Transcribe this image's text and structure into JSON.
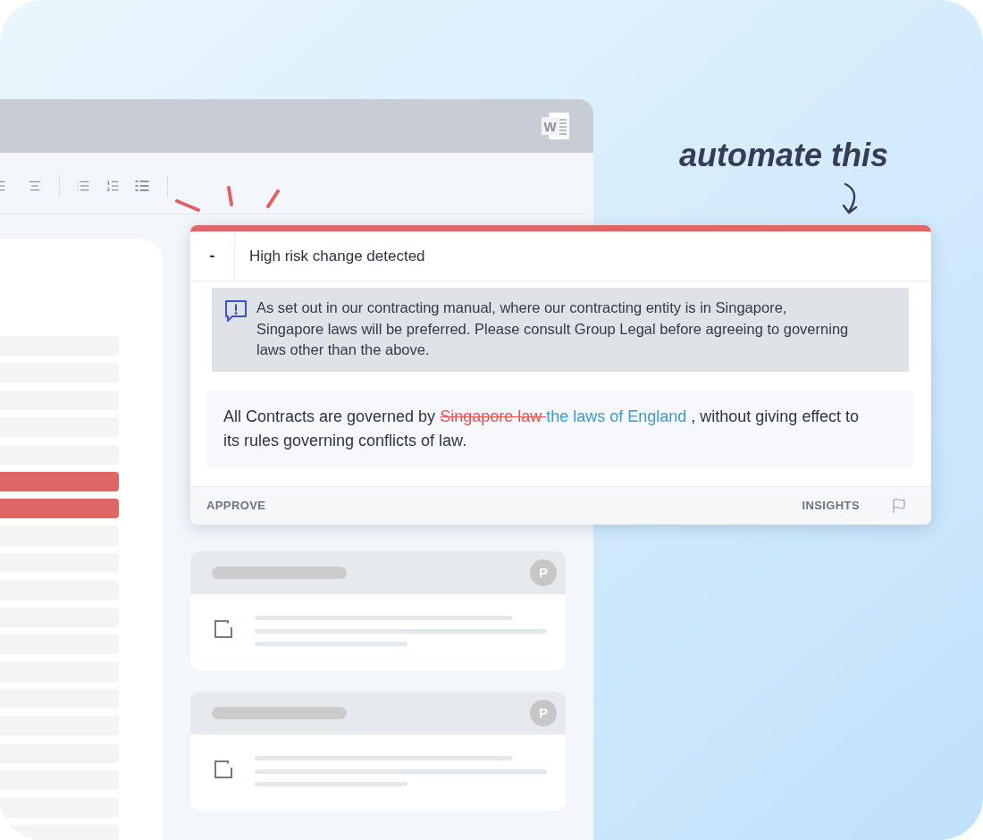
{
  "annotation": {
    "text": "automate this"
  },
  "window": {
    "app_icon_letter": "W"
  },
  "document": {
    "lines": [
      {
        "highlighted": false
      },
      {
        "highlighted": false
      },
      {
        "highlighted": false
      },
      {
        "highlighted": false
      },
      {
        "highlighted": false
      },
      {
        "highlighted": true
      },
      {
        "highlighted": true
      },
      {
        "highlighted": false
      },
      {
        "highlighted": false
      },
      {
        "highlighted": false
      },
      {
        "highlighted": false
      },
      {
        "highlighted": false
      },
      {
        "highlighted": false
      },
      {
        "highlighted": false
      },
      {
        "highlighted": false
      },
      {
        "highlighted": false
      },
      {
        "highlighted": false
      },
      {
        "highlighted": false
      },
      {
        "highlighted": false
      }
    ]
  },
  "alert": {
    "collapse_label": "-",
    "title": "High risk change detected",
    "guidance": "As set out in our contracting manual, where our contracting entity is in Singapore, Singapore laws will be preferred. Please consult Group Legal before agreeing to governing laws other than the above.",
    "clause": [
      {
        "kind": "plain",
        "text": "All Contracts are governed by "
      },
      {
        "kind": "deleted",
        "text": "Singapore law "
      },
      {
        "kind": "inserted",
        "text": "the laws of England"
      },
      {
        "kind": "plain",
        "text": " , without giving effect to its rules governing conflicts of law."
      }
    ],
    "actions": {
      "approve": "APPROVE",
      "insights": "INSIGHTS"
    }
  },
  "cards": [
    {
      "badge": "P",
      "checked": false
    },
    {
      "badge": "P",
      "checked": false
    }
  ]
}
